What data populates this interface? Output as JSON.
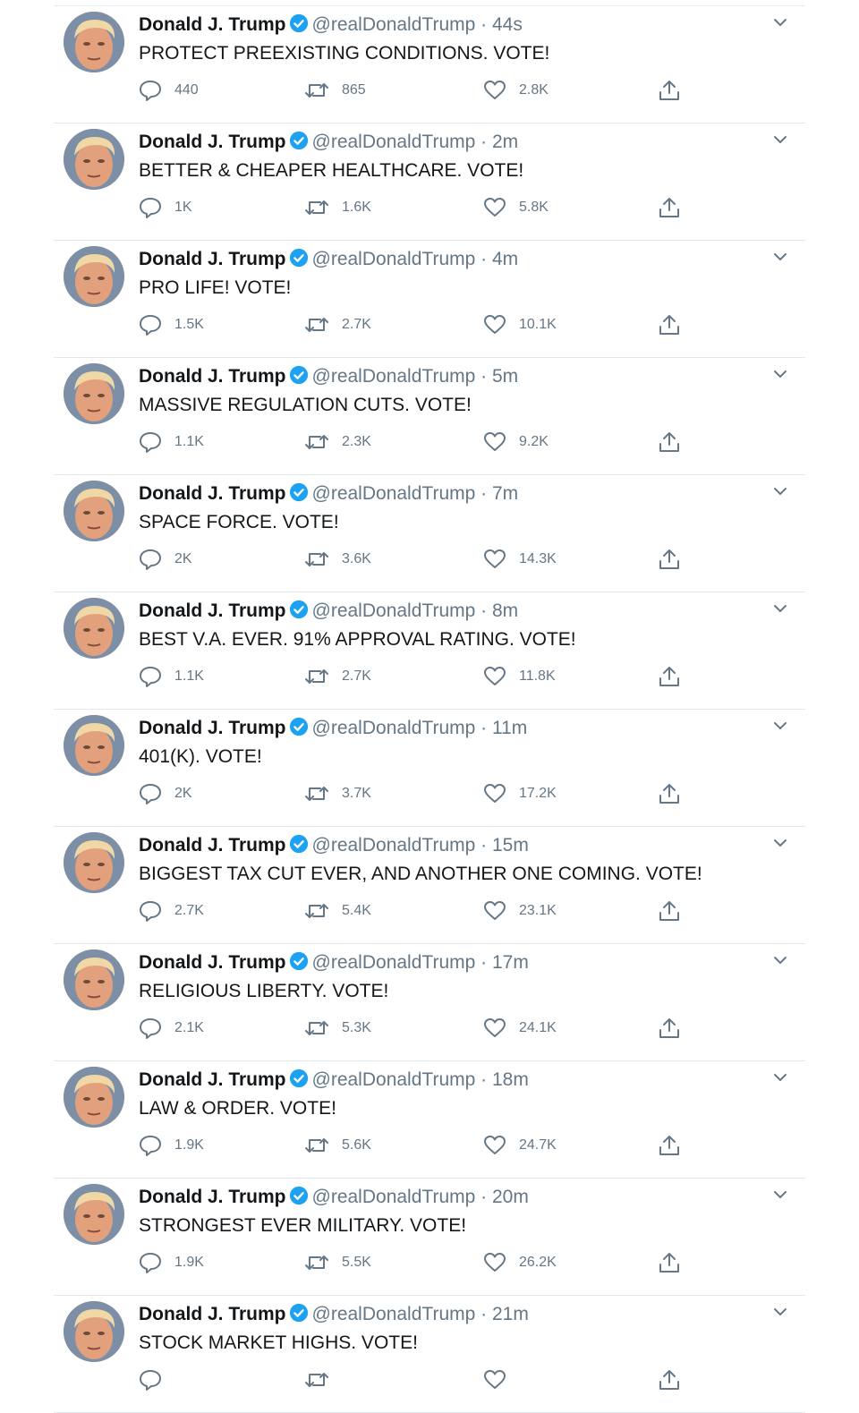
{
  "colors": {
    "text": "#14171a",
    "muted": "#657786",
    "verified": "#1da1f2",
    "border": "#e1e8ed"
  },
  "icons": {
    "reply": "reply-bubble-icon",
    "retweet": "retweet-icon",
    "like": "heart-icon",
    "share": "share-icon",
    "menu": "chevron-down-icon",
    "verified": "verified-badge-icon"
  },
  "tweets": [
    {
      "name": "Donald J. Trump",
      "handle": "@realDonaldTrump",
      "sep": "·",
      "time": "44s",
      "text": "PROTECT PREEXISTING CONDITIONS. VOTE!",
      "replies": "440",
      "retweets": "865",
      "likes": "2.8K"
    },
    {
      "name": "Donald J. Trump",
      "handle": "@realDonaldTrump",
      "sep": "·",
      "time": "2m",
      "text": "BETTER & CHEAPER HEALTHCARE. VOTE!",
      "replies": "1K",
      "retweets": "1.6K",
      "likes": "5.8K"
    },
    {
      "name": "Donald J. Trump",
      "handle": "@realDonaldTrump",
      "sep": "·",
      "time": "4m",
      "text": "PRO LIFE! VOTE!",
      "replies": "1.5K",
      "retweets": "2.7K",
      "likes": "10.1K"
    },
    {
      "name": "Donald J. Trump",
      "handle": "@realDonaldTrump",
      "sep": "·",
      "time": "5m",
      "text": "MASSIVE REGULATION CUTS. VOTE!",
      "replies": "1.1K",
      "retweets": "2.3K",
      "likes": "9.2K"
    },
    {
      "name": "Donald J. Trump",
      "handle": "@realDonaldTrump",
      "sep": "·",
      "time": "7m",
      "text": "SPACE FORCE. VOTE!",
      "replies": "2K",
      "retweets": "3.6K",
      "likes": "14.3K"
    },
    {
      "name": "Donald J. Trump",
      "handle": "@realDonaldTrump",
      "sep": "·",
      "time": "8m",
      "text": "BEST V.A. EVER. 91% APPROVAL RATING. VOTE!",
      "replies": "1.1K",
      "retweets": "2.7K",
      "likes": "11.8K"
    },
    {
      "name": "Donald J. Trump",
      "handle": "@realDonaldTrump",
      "sep": "·",
      "time": "11m",
      "text": "401(K). VOTE!",
      "replies": "2K",
      "retweets": "3.7K",
      "likes": "17.2K"
    },
    {
      "name": "Donald J. Trump",
      "handle": "@realDonaldTrump",
      "sep": "·",
      "time": "15m",
      "text": "BIGGEST TAX CUT EVER, AND ANOTHER ONE COMING. VOTE!",
      "replies": "2.7K",
      "retweets": "5.4K",
      "likes": "23.1K"
    },
    {
      "name": "Donald J. Trump",
      "handle": "@realDonaldTrump",
      "sep": "·",
      "time": "17m",
      "text": "RELIGIOUS LIBERTY. VOTE!",
      "replies": "2.1K",
      "retweets": "5.3K",
      "likes": "24.1K"
    },
    {
      "name": "Donald J. Trump",
      "handle": "@realDonaldTrump",
      "sep": "·",
      "time": "18m",
      "text": "LAW & ORDER. VOTE!",
      "replies": "1.9K",
      "retweets": "5.6K",
      "likes": "24.7K"
    },
    {
      "name": "Donald J. Trump",
      "handle": "@realDonaldTrump",
      "sep": "·",
      "time": "20m",
      "text": "STRONGEST EVER MILITARY. VOTE!",
      "replies": "1.9K",
      "retweets": "5.5K",
      "likes": "26.2K"
    },
    {
      "name": "Donald J. Trump",
      "handle": "@realDonaldTrump",
      "sep": "·",
      "time": "21m",
      "text": "STOCK MARKET HIGHS. VOTE!",
      "replies": "",
      "retweets": "",
      "likes": ""
    }
  ]
}
